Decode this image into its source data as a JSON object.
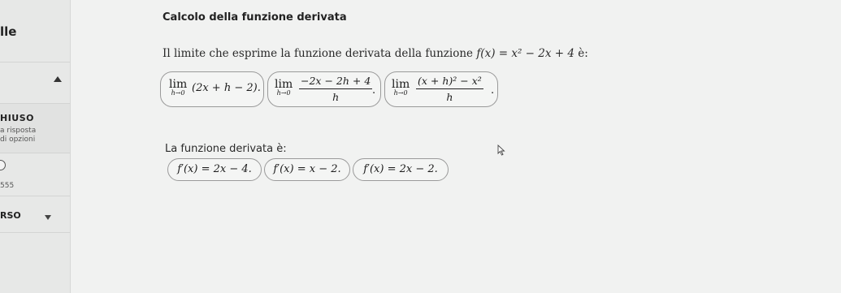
{
  "sidebar": {
    "top_label": "lle",
    "section_title": "HIUSO",
    "sub1": "a risposta",
    "sub2": "di opzioni",
    "number": "555",
    "bottom_label": "RSO"
  },
  "exercise": {
    "title": "Calcolo della funzione derivata",
    "question_text": "Il limite che esprime la funzione derivata della funzione",
    "question_math": "f(x) = x² − 2x + 4",
    "question_suffix": "è:",
    "lim_options": [
      {
        "lim": "lim",
        "sub": "h→0",
        "expr": "(2x + h − 2)."
      },
      {
        "lim": "lim",
        "sub": "h→0",
        "numerator": "−2x − 2h + 4",
        "denominator": "h",
        "end": "."
      },
      {
        "lim": "lim",
        "sub": "h→0",
        "numerator": "(x + h)² − x²",
        "denominator": "h",
        "end": "."
      }
    ],
    "subtitle": "La funzione derivata è:",
    "answer_options": [
      "f′(x) = 2x − 4.",
      "f′(x) = x − 2.",
      "f′(x) = 2x − 2."
    ]
  },
  "icons": {
    "up": "triangle-up-icon",
    "down": "triangle-down-icon",
    "radio": "radio-icon",
    "cursor": "mouse-cursor-icon"
  },
  "colors": {
    "background": "#f1f2f1",
    "sidebar": "#e7e8e7",
    "chip_border": "#9a9a9a"
  }
}
